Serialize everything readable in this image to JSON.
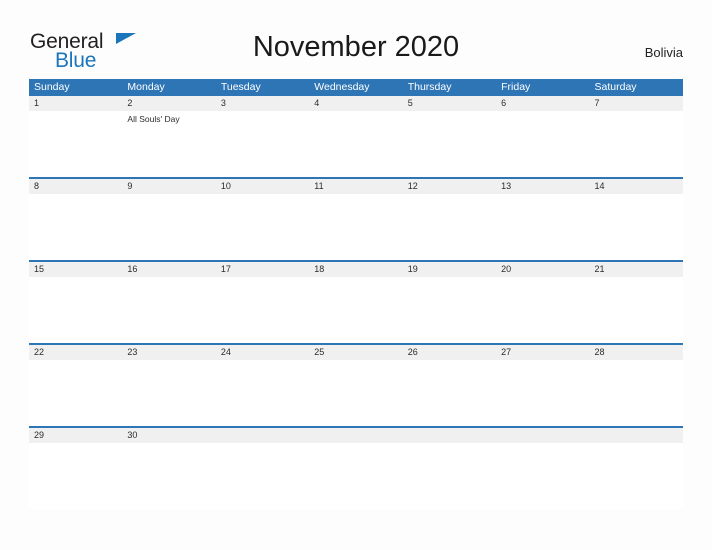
{
  "brand": {
    "name_top": "General",
    "name_bottom": "Blue",
    "flag_icon": "flag-triangle-icon",
    "color_dark": "#231f20",
    "color_blue": "#1b75bb"
  },
  "header": {
    "title": "November 2020",
    "country": "Bolivia"
  },
  "theme": {
    "header_blue": "#2e75b6",
    "date_strip_gray": "#f0f0f0",
    "page_background": "#fdfdfd",
    "text_color": "#222222"
  },
  "calendar": {
    "month": "November",
    "year": "2020",
    "weekdays": [
      "Sunday",
      "Monday",
      "Tuesday",
      "Wednesday",
      "Thursday",
      "Friday",
      "Saturday"
    ],
    "weeks": [
      {
        "days": [
          {
            "date": "1",
            "event": ""
          },
          {
            "date": "2",
            "event": "All Souls' Day"
          },
          {
            "date": "3",
            "event": ""
          },
          {
            "date": "4",
            "event": ""
          },
          {
            "date": "5",
            "event": ""
          },
          {
            "date": "6",
            "event": ""
          },
          {
            "date": "7",
            "event": ""
          }
        ]
      },
      {
        "days": [
          {
            "date": "8",
            "event": ""
          },
          {
            "date": "9",
            "event": ""
          },
          {
            "date": "10",
            "event": ""
          },
          {
            "date": "11",
            "event": ""
          },
          {
            "date": "12",
            "event": ""
          },
          {
            "date": "13",
            "event": ""
          },
          {
            "date": "14",
            "event": ""
          }
        ]
      },
      {
        "days": [
          {
            "date": "15",
            "event": ""
          },
          {
            "date": "16",
            "event": ""
          },
          {
            "date": "17",
            "event": ""
          },
          {
            "date": "18",
            "event": ""
          },
          {
            "date": "19",
            "event": ""
          },
          {
            "date": "20",
            "event": ""
          },
          {
            "date": "21",
            "event": ""
          }
        ]
      },
      {
        "days": [
          {
            "date": "22",
            "event": ""
          },
          {
            "date": "23",
            "event": ""
          },
          {
            "date": "24",
            "event": ""
          },
          {
            "date": "25",
            "event": ""
          },
          {
            "date": "26",
            "event": ""
          },
          {
            "date": "27",
            "event": ""
          },
          {
            "date": "28",
            "event": ""
          }
        ]
      },
      {
        "days": [
          {
            "date": "29",
            "event": ""
          },
          {
            "date": "30",
            "event": ""
          },
          {
            "date": "",
            "event": ""
          },
          {
            "date": "",
            "event": ""
          },
          {
            "date": "",
            "event": ""
          },
          {
            "date": "",
            "event": ""
          },
          {
            "date": "",
            "event": ""
          }
        ]
      }
    ]
  }
}
